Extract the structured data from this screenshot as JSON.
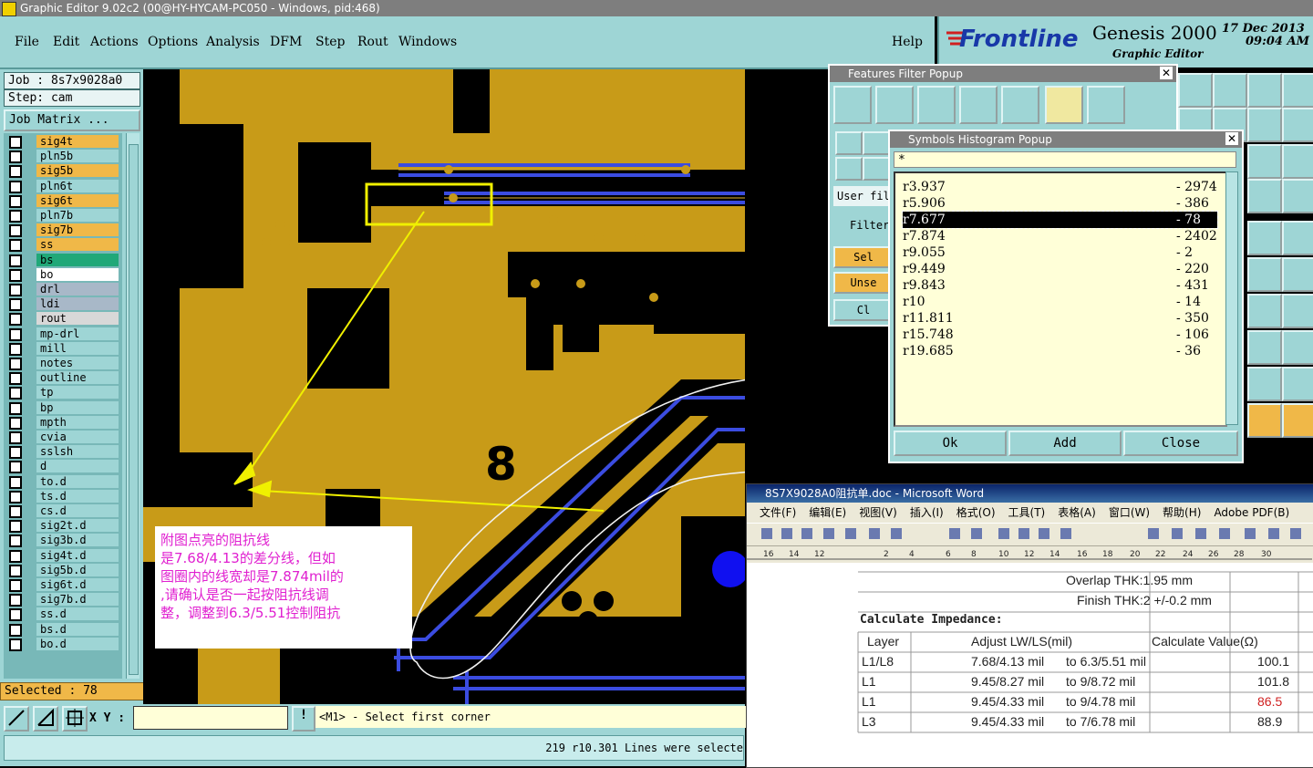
{
  "window": {
    "title": "Graphic Editor 9.02c2 (00@HY-HYCAM-PC050 - Windows, pid:468)"
  },
  "menu": [
    "File",
    "Edit",
    "Actions",
    "Options",
    "Analysis",
    "DFM",
    "Step",
    "Rout",
    "Windows"
  ],
  "help": "Help",
  "brand": {
    "logo": "Frontline",
    "product": "Genesis 2000",
    "subtitle": "Graphic Editor",
    "date": "17 Dec 2013",
    "time": "09:04 AM"
  },
  "job": {
    "job_label": "Job : 8s7x9028a0",
    "step_label": "Step: cam",
    "matrix_button": "Job Matrix ..."
  },
  "layers": [
    {
      "name": "sig4t",
      "color": "#f0b848"
    },
    {
      "name": "pln5b",
      "color": "#9ed5d5"
    },
    {
      "name": "sig5b",
      "color": "#f0b848"
    },
    {
      "name": "pln6t",
      "color": "#9ed5d5"
    },
    {
      "name": "sig6t",
      "color": "#f0b848"
    },
    {
      "name": "pln7b",
      "color": "#9ed5d5"
    },
    {
      "name": "sig7b",
      "color": "#f0b848"
    },
    {
      "name": "ss",
      "color": "#f0b848"
    },
    {
      "name": "bs",
      "color": "#20a878"
    },
    {
      "name": "bo",
      "color": "#ffffff"
    },
    {
      "name": "drl",
      "color": "#a8b8c8"
    },
    {
      "name": "ldi",
      "color": "#a8b8c8"
    },
    {
      "name": "rout",
      "color": "#d8d8d8"
    },
    {
      "name": "mp-drl",
      "color": "#9ed5d5"
    },
    {
      "name": "mill",
      "color": "#9ed5d5"
    },
    {
      "name": "notes",
      "color": "#9ed5d5"
    },
    {
      "name": "outline",
      "color": "#9ed5d5"
    },
    {
      "name": "tp",
      "color": "#9ed5d5"
    },
    {
      "name": "bp",
      "color": "#9ed5d5"
    },
    {
      "name": "mpth",
      "color": "#9ed5d5"
    },
    {
      "name": "cvia",
      "color": "#9ed5d5"
    },
    {
      "name": "sslsh",
      "color": "#9ed5d5"
    },
    {
      "name": "d",
      "color": "#9ed5d5"
    },
    {
      "name": "to.d",
      "color": "#9ed5d5"
    },
    {
      "name": "ts.d",
      "color": "#9ed5d5"
    },
    {
      "name": "cs.d",
      "color": "#9ed5d5"
    },
    {
      "name": "sig2t.d",
      "color": "#9ed5d5"
    },
    {
      "name": "sig3b.d",
      "color": "#9ed5d5"
    },
    {
      "name": "sig4t.d",
      "color": "#9ed5d5"
    },
    {
      "name": "sig5b.d",
      "color": "#9ed5d5"
    },
    {
      "name": "sig6t.d",
      "color": "#9ed5d5"
    },
    {
      "name": "sig7b.d",
      "color": "#9ed5d5"
    },
    {
      "name": "ss.d",
      "color": "#9ed5d5"
    },
    {
      "name": "bs.d",
      "color": "#9ed5d5"
    },
    {
      "name": "bo.d",
      "color": "#9ed5d5"
    }
  ],
  "selected": "Selected : 78",
  "cmd": {
    "xy_label": "X Y :",
    "prompt": "<M1> - Select first corner"
  },
  "status_text": "219 r10.301 Lines were selecte",
  "annotation": [
    "附图点亮的阻抗线",
    "是7.68/4.13的差分线，但如",
    "图圈内的线宽却是7.874mil的",
    ",请确认是否一起按阻抗线调",
    "整，调整到6.3/5.51控制阻抗"
  ],
  "filter_popup": {
    "title": "Features Filter Popup",
    "user_filter": "User fil",
    "filter": "Filter",
    "select": "Sel",
    "unselect": "Unse",
    "clear": "Cl"
  },
  "histogram_popup": {
    "title": "Symbols Histogram Popup",
    "filter_value": "*",
    "rows": [
      {
        "name": "r3.937",
        "count": "- 2974"
      },
      {
        "name": "r5.906",
        "count": "- 386"
      },
      {
        "name": "r7.677",
        "count": "- 78"
      },
      {
        "name": "r7.874",
        "count": "- 2402"
      },
      {
        "name": "r9.055",
        "count": "- 2"
      },
      {
        "name": "r9.449",
        "count": "- 220"
      },
      {
        "name": "r9.843",
        "count": "- 431"
      },
      {
        "name": "r10",
        "count": "- 14"
      },
      {
        "name": "r11.811",
        "count": "- 350"
      },
      {
        "name": "r15.748",
        "count": "- 106"
      },
      {
        "name": "r19.685",
        "count": "- 36"
      }
    ],
    "ok": "Ok",
    "add": "Add",
    "close": "Close"
  },
  "word": {
    "title": "8S7X9028A0阻抗单.doc - Microsoft Word",
    "menu": [
      "文件(F)",
      "编辑(E)",
      "视图(V)",
      "插入(I)",
      "格式(O)",
      "工具(T)",
      "表格(A)",
      "窗口(W)",
      "帮助(H)",
      "Adobe PDF(B)"
    ],
    "overlap": "Overlap THK:1.95 mm",
    "finish": "Finish THK:2 +/-0.2 mm",
    "calc": "Calculate Impedance:",
    "headers": [
      "Layer",
      "Adjust LW/LS(mil)",
      "Calculate Value(Ω)"
    ],
    "rows": [
      {
        "layer": "L1/L8",
        "orig": "7.68/4.13 mil",
        "adj": "to  6.3/5.51 mil",
        "val": "100.1"
      },
      {
        "layer": "L1",
        "orig": "9.45/8.27 mil",
        "adj": "to  9/8.72 mil",
        "val": "101.8"
      },
      {
        "layer": "L1",
        "orig": "9.45/4.33 mil",
        "adj": "to  9/4.78 mil",
        "val": "86.5"
      },
      {
        "layer": "L3",
        "orig": "9.45/4.33 mil",
        "adj": "to  7/6.78 mil",
        "val": "88.9"
      }
    ]
  },
  "pcb_label": "8"
}
